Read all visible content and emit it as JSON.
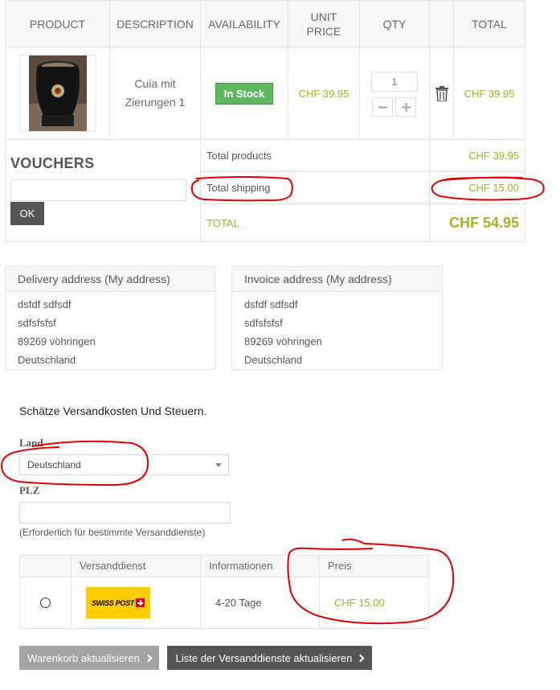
{
  "cart": {
    "headers": {
      "product": "PRODUCT",
      "description": "DESCRIPTION",
      "availability": "AVAILABILITY",
      "unit_price": "UNIT PRICE",
      "qty": "QTY",
      "total": "TOTAL"
    },
    "item": {
      "name": "Cuia mit Zierungen 1",
      "availability": "In Stock",
      "unit_price": "CHF 39.95",
      "qty": "1",
      "total": "CHF 39.95"
    },
    "vouchers_title": "VOUCHERS",
    "vouchers_ok": "OK",
    "summary": {
      "total_products_label": "Total products",
      "total_products_value": "CHF 39.95",
      "total_shipping_label": "Total shipping",
      "total_shipping_value": "CHF 15.00",
      "total_label": "TOTAL",
      "total_value": "CHF 54.95"
    }
  },
  "addresses": {
    "delivery": {
      "title": "Delivery address (My address)",
      "lines": [
        "dsfdf sdfsdf",
        "sdfsfsfsf",
        "89269 vöhringen",
        "Deutschland"
      ]
    },
    "invoice": {
      "title": "Invoice address (My address)",
      "lines": [
        "dsfdf sdfsdf",
        "sdfsfsfsf",
        "89269 vöhringen",
        "Deutschland"
      ]
    }
  },
  "estimate": {
    "title": "Schätze Versandkosten Und Steuern.",
    "country_label": "Land",
    "country_value": "Deutschland",
    "zip_label": "PLZ",
    "zip_note": "(Erforderlich für bestimmte Versanddienste)",
    "table": {
      "col_service": "Versanddienst",
      "col_info": "Informationen",
      "col_price": "Preis",
      "row": {
        "logo_text": "SWISS POST",
        "info": "4-20 Tage",
        "price": "CHF 15.00"
      }
    }
  },
  "buttons": {
    "update_cart": "Warenkorb aktualisieren",
    "update_services": "Liste der Versanddienste aktualisieren"
  },
  "colors": {
    "accent": "#a4b226",
    "stock_green": "#5cb85c",
    "annotation_red": "#e00000"
  }
}
